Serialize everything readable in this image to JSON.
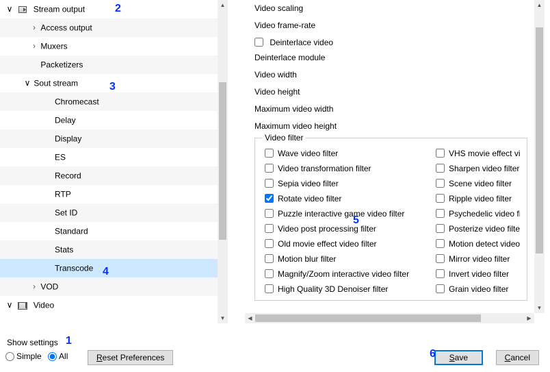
{
  "tree": {
    "stream_output": "Stream output",
    "access_output": "Access output",
    "muxers": "Muxers",
    "packetizers": "Packetizers",
    "sout_stream": "Sout stream",
    "chromecast": "Chromecast",
    "delay": "Delay",
    "display": "Display",
    "es": "ES",
    "record": "Record",
    "rtp": "RTP",
    "set_id": "Set ID",
    "standard": "Standard",
    "stats": "Stats",
    "transcode": "Transcode",
    "vod": "VOD",
    "video": "Video"
  },
  "detail": {
    "video_scaling": "Video scaling",
    "video_frame_rate": "Video frame-rate",
    "deinterlace_video": "Deinterlace video",
    "deinterlace_module": "Deinterlace module",
    "video_width": "Video width",
    "video_height": "Video height",
    "max_video_width": "Maximum video width",
    "max_video_height": "Maximum video height",
    "group_title": "Video filter",
    "filters_colA": [
      {
        "label": "Wave video filter",
        "checked": false
      },
      {
        "label": "Video transformation filter",
        "checked": false
      },
      {
        "label": "Sepia video filter",
        "checked": false
      },
      {
        "label": "Rotate video filter",
        "checked": true
      },
      {
        "label": "Puzzle interactive game video filter",
        "checked": false
      },
      {
        "label": "Video post processing filter",
        "checked": false
      },
      {
        "label": "Old movie effect video filter",
        "checked": false
      },
      {
        "label": "Motion blur filter",
        "checked": false
      },
      {
        "label": "Magnify/Zoom interactive video filter",
        "checked": false
      },
      {
        "label": "High Quality 3D Denoiser filter",
        "checked": false
      }
    ],
    "filters_colB": [
      {
        "label": "VHS movie effect video filter",
        "checked": false
      },
      {
        "label": "Sharpen video filter",
        "checked": false
      },
      {
        "label": "Scene video filter",
        "checked": false
      },
      {
        "label": "Ripple video filter",
        "checked": false
      },
      {
        "label": "Psychedelic video filter",
        "checked": false
      },
      {
        "label": "Posterize video filter",
        "checked": false
      },
      {
        "label": "Motion detect video filter",
        "checked": false
      },
      {
        "label": "Mirror video filter",
        "checked": false
      },
      {
        "label": "Invert video filter",
        "checked": false
      },
      {
        "label": "Grain video filter",
        "checked": false
      }
    ]
  },
  "bottom": {
    "show_settings": "Show settings",
    "simple": "Simple",
    "all": "All",
    "reset": "Reset Preferences",
    "save": "Save",
    "cancel": "Cancel"
  },
  "annotations": {
    "a1": "1",
    "a2": "2",
    "a3": "3",
    "a4": "4",
    "a5": "5",
    "a6": "6"
  }
}
